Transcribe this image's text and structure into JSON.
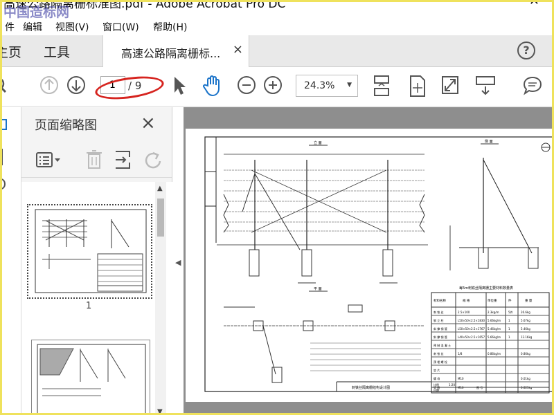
{
  "window": {
    "title": "高速公路隔离栅标准图.pdf - Adobe Acrobat Pro DC",
    "watermark": "中国造标网"
  },
  "menu": {
    "file": "件",
    "edit": "编辑",
    "view": "视图(V)",
    "window": "窗口(W)",
    "help": "帮助(H)"
  },
  "tabs": {
    "home": "主页",
    "tools": "工具",
    "document": "高速公路隔离栅标...",
    "close": "×",
    "help": "?"
  },
  "toolbar": {
    "page_current": "1",
    "page_total": "/ 9",
    "zoom": "24.3%",
    "zoom_caret": "▼"
  },
  "sidebar": {
    "title": "页面缩略图",
    "close": "×",
    "thumbnails": [
      {
        "page": "1"
      }
    ]
  },
  "drawing": {
    "section_titles": [
      "立 面",
      "侧 面",
      "平 面"
    ],
    "table_title": "每5m刺铁丝隔离栅主要材料数量表",
    "table_headers": [
      "材料名称",
      "规 格",
      "单位重",
      "件",
      "重 量"
    ],
    "table_rows": [
      [
        "刺 铁 丝",
        "2.5×100",
        "2.3kg/m",
        "5件",
        "26.6kg"
      ],
      [
        "钢 立 柱",
        "L50×50×2.5×1830",
        "5.66kg/m",
        "1",
        "5.67kg"
      ],
      [
        "斜 撑 钢 管",
        "L50×50×2.5×1767",
        "5.46kg/m",
        "1",
        "5.46kg"
      ],
      [
        "斜 撑 钢 管",
        "L40×50×2.5×1657",
        "5.66kg/m",
        "1",
        "12.16kg"
      ],
      [
        "预 制 混 凝 土",
        "",
        "",
        "",
        ""
      ],
      [
        "刺 铁 丝",
        "1/8",
        "0.86kg/m",
        "",
        "0.86kg"
      ],
      [
        "预 埋 螺 栓",
        "",
        "",
        "",
        ""
      ],
      [
        "垫 片",
        "",
        "",
        "",
        ""
      ],
      [
        "螺 母",
        "M10",
        "",
        "",
        "0.01kg"
      ],
      [
        "垫 圈",
        "M10",
        "",
        "",
        "0.021kg"
      ]
    ],
    "title_block": {
      "name": "刺铁丝隔离栅结构设计图",
      "scale_label": "比例",
      "scale": "1:20",
      "date_label": "日期",
      "drawing_no_label": "图 号"
    }
  },
  "colors": {
    "accent_blue": "#1a73c9",
    "annotation_red": "#d6241f",
    "frame_yellow": "#efe25c"
  }
}
